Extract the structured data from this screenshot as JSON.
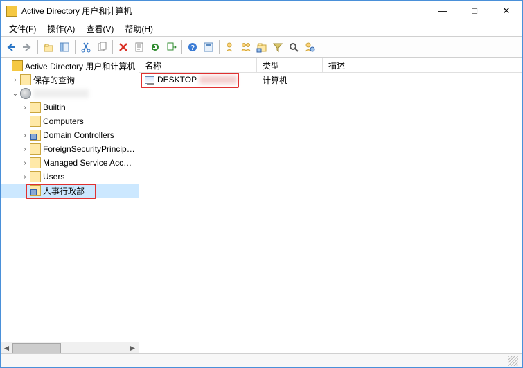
{
  "window": {
    "title": "Active Directory 用户和计算机"
  },
  "menus": {
    "file": "文件(F)",
    "action": "操作(A)",
    "view": "查看(V)",
    "help": "帮助(H)"
  },
  "tree": {
    "root": "Active Directory 用户和计算机",
    "saved_queries": "保存的查询",
    "domain": "",
    "builtin": "Builtin",
    "computers": "Computers",
    "domain_controllers": "Domain Controllers",
    "fsp": "ForeignSecurityPrincipals",
    "msa": "Managed Service Accounts",
    "users": "Users",
    "hr_ou": "人事行政部"
  },
  "list": {
    "columns": {
      "name": "名称",
      "type": "类型",
      "desc": "描述"
    },
    "rows": [
      {
        "name": "DESKTOP",
        "type": "计算机",
        "desc": ""
      }
    ]
  }
}
